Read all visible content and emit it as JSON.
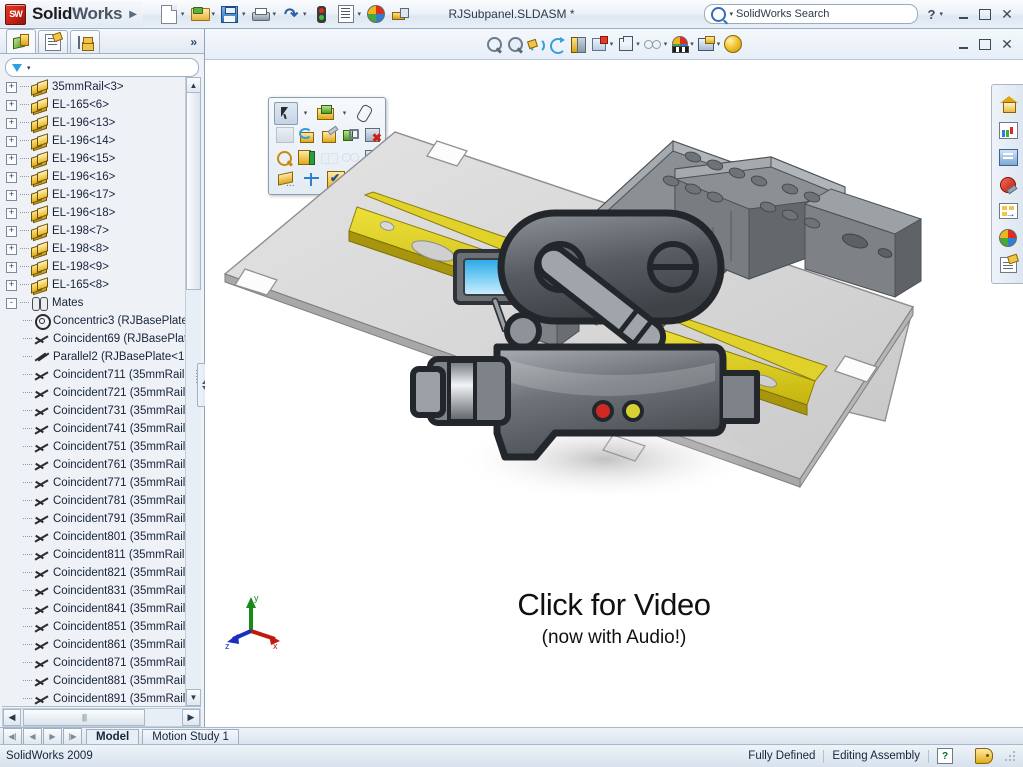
{
  "app": {
    "brand_prefix": "Solid",
    "brand_suffix": "Works",
    "document_title": "RJSubpanel.SLDASM *",
    "version_label": "SolidWorks 2009"
  },
  "titlebar": {
    "menu_caret": "▶",
    "quick_access": [
      {
        "name": "new-document",
        "label": "New",
        "icon": "new-document-icon",
        "has_dropdown": true
      },
      {
        "name": "open-document",
        "label": "Open",
        "icon": "open-folder-icon",
        "has_dropdown": true
      },
      {
        "name": "save-document",
        "label": "Save",
        "icon": "save-disk-icon",
        "has_dropdown": true
      },
      {
        "name": "print-document",
        "label": "Print",
        "icon": "printer-icon",
        "has_dropdown": true
      },
      {
        "name": "undo",
        "label": "Undo",
        "icon": "undo-arrow-icon",
        "has_dropdown": true
      },
      {
        "name": "rebuild",
        "label": "Rebuild",
        "icon": "traffic-light-icon",
        "has_dropdown": false
      },
      {
        "name": "options",
        "label": "Options",
        "icon": "options-list-icon",
        "has_dropdown": true
      },
      {
        "name": "appearances",
        "label": "Edit Appearance",
        "icon": "color-wheel-icon",
        "has_dropdown": false
      },
      {
        "name": "measure",
        "label": "Measure",
        "icon": "measure-icon",
        "has_dropdown": false
      }
    ],
    "search": {
      "placeholder": "SolidWorks Search",
      "value": "SolidWorks Search",
      "icon": "search-magnifier-icon",
      "dropdown": "▾"
    },
    "help_label": "?",
    "help_dropdown": "▾",
    "window_buttons": [
      "minimize",
      "maximize",
      "close"
    ]
  },
  "left_panel": {
    "tabs": [
      {
        "name": "feature-manager",
        "icon": "feature-tree-icon",
        "active": true,
        "title": "FeatureManager design tree"
      },
      {
        "name": "property-manager",
        "icon": "property-manager-icon",
        "active": false,
        "title": "PropertyManager"
      },
      {
        "name": "configuration-manager",
        "icon": "configuration-manager-icon",
        "active": false,
        "title": "ConfigurationManager"
      }
    ],
    "more_tabs_label": "»",
    "filter": {
      "placeholder": "",
      "value": "",
      "icon": "filter-funnel-icon",
      "dropdown": "▾"
    },
    "tree": [
      {
        "label": "35mmRail<3>",
        "icon": "part-icon",
        "expander": "+",
        "depth": 0
      },
      {
        "label": "EL-165<6>",
        "icon": "part-icon",
        "expander": "+",
        "depth": 0
      },
      {
        "label": "EL-196<13>",
        "icon": "part-icon",
        "expander": "+",
        "depth": 0
      },
      {
        "label": "EL-196<14>",
        "icon": "part-icon",
        "expander": "+",
        "depth": 0
      },
      {
        "label": "EL-196<15>",
        "icon": "part-icon",
        "expander": "+",
        "depth": 0
      },
      {
        "label": "EL-196<16>",
        "icon": "part-icon",
        "expander": "+",
        "depth": 0
      },
      {
        "label": "EL-196<17>",
        "icon": "part-icon",
        "expander": "+",
        "depth": 0
      },
      {
        "label": "EL-196<18>",
        "icon": "part-icon",
        "expander": "+",
        "depth": 0
      },
      {
        "label": "EL-198<7>",
        "icon": "part-icon",
        "expander": "+",
        "depth": 0
      },
      {
        "label": "EL-198<8>",
        "icon": "part-icon",
        "expander": "+",
        "depth": 0
      },
      {
        "label": "EL-198<9>",
        "icon": "part-icon",
        "expander": "+",
        "depth": 0
      },
      {
        "label": "EL-165<8>",
        "icon": "part-icon",
        "expander": "+",
        "depth": 0
      },
      {
        "label": "Mates",
        "icon": "mates-folder-icon",
        "expander": "-",
        "depth": 0
      },
      {
        "label": "Concentric3 (RJBasePlate",
        "icon": "concentric-mate-icon",
        "expander": "",
        "depth": 1
      },
      {
        "label": "Coincident69 (RJBasePlat",
        "icon": "coincident-mate-icon",
        "expander": "",
        "depth": 1
      },
      {
        "label": "Parallel2 (RJBasePlate<1:",
        "icon": "parallel-mate-icon",
        "expander": "",
        "depth": 1
      },
      {
        "label": "Coincident711 (35mmRail",
        "icon": "coincident-mate-icon",
        "expander": "",
        "depth": 1
      },
      {
        "label": "Coincident721 (35mmRail",
        "icon": "coincident-mate-icon",
        "expander": "",
        "depth": 1
      },
      {
        "label": "Coincident731 (35mmRail",
        "icon": "coincident-mate-icon",
        "expander": "",
        "depth": 1
      },
      {
        "label": "Coincident741 (35mmRail",
        "icon": "coincident-mate-icon",
        "expander": "",
        "depth": 1
      },
      {
        "label": "Coincident751 (35mmRail",
        "icon": "coincident-mate-icon",
        "expander": "",
        "depth": 1
      },
      {
        "label": "Coincident761 (35mmRail",
        "icon": "coincident-mate-icon",
        "expander": "",
        "depth": 1
      },
      {
        "label": "Coincident771 (35mmRail",
        "icon": "coincident-mate-icon",
        "expander": "",
        "depth": 1
      },
      {
        "label": "Coincident781 (35mmRail",
        "icon": "coincident-mate-icon",
        "expander": "",
        "depth": 1
      },
      {
        "label": "Coincident791 (35mmRail",
        "icon": "coincident-mate-icon",
        "expander": "",
        "depth": 1
      },
      {
        "label": "Coincident801 (35mmRail",
        "icon": "coincident-mate-icon",
        "expander": "",
        "depth": 1
      },
      {
        "label": "Coincident811 (35mmRail",
        "icon": "coincident-mate-icon",
        "expander": "",
        "depth": 1
      },
      {
        "label": "Coincident821 (35mmRail",
        "icon": "coincident-mate-icon",
        "expander": "",
        "depth": 1
      },
      {
        "label": "Coincident831 (35mmRail",
        "icon": "coincident-mate-icon",
        "expander": "",
        "depth": 1
      },
      {
        "label": "Coincident841 (35mmRail",
        "icon": "coincident-mate-icon",
        "expander": "",
        "depth": 1
      },
      {
        "label": "Coincident851 (35mmRail",
        "icon": "coincident-mate-icon",
        "expander": "",
        "depth": 1
      },
      {
        "label": "Coincident861 (35mmRail",
        "icon": "coincident-mate-icon",
        "expander": "",
        "depth": 1
      },
      {
        "label": "Coincident871 (35mmRail",
        "icon": "coincident-mate-icon",
        "expander": "",
        "depth": 1
      },
      {
        "label": "Coincident881 (35mmRail",
        "icon": "coincident-mate-icon",
        "expander": "",
        "depth": 1
      },
      {
        "label": "Coincident891 (35mmRail",
        "icon": "coincident-mate-icon",
        "expander": "",
        "depth": 1
      }
    ],
    "scroll_up": "▲",
    "scroll_down": "▼",
    "scroll_left": "◄",
    "scroll_right": "►"
  },
  "view_toolbar": [
    {
      "name": "zoom-to-fit",
      "icon": "zoom-to-fit-icon",
      "label": "Zoom to Fit",
      "has_dropdown": false
    },
    {
      "name": "zoom-to-area",
      "icon": "zoom-to-area-icon",
      "label": "Zoom to Area",
      "has_dropdown": false
    },
    {
      "name": "previous-view",
      "icon": "previous-view-icon",
      "label": "Previous View",
      "has_dropdown": false
    },
    {
      "name": "rotate-view",
      "icon": "rotate-view-icon",
      "label": "Rotate View",
      "has_dropdown": false
    },
    {
      "name": "section-view",
      "icon": "section-view-icon",
      "label": "Section View",
      "has_dropdown": false
    },
    {
      "name": "view-orientation",
      "icon": "view-orientation-icon",
      "label": "View Orientation",
      "has_dropdown": true
    },
    {
      "name": "display-style",
      "icon": "display-style-icon",
      "label": "Display Style",
      "has_dropdown": true
    },
    {
      "name": "hide-show-items",
      "icon": "hide-show-icon",
      "label": "Hide/Show Items",
      "has_dropdown": true
    },
    {
      "name": "edit-appearance",
      "icon": "appearance-wheel-icon",
      "label": "Edit Appearance",
      "has_dropdown": true
    },
    {
      "name": "apply-scene",
      "icon": "apply-scene-icon",
      "label": "Apply Scene",
      "has_dropdown": true
    },
    {
      "name": "view-settings",
      "icon": "shadow-ball-icon",
      "label": "View Settings",
      "has_dropdown": false
    }
  ],
  "document_window_buttons": [
    "minimize",
    "restore",
    "close"
  ],
  "context_toolbar": {
    "rows": [
      [
        {
          "name": "select",
          "icon": "select-arrow-icon",
          "state": "selected",
          "has_dropdown": true
        },
        {
          "name": "open-part",
          "icon": "open-part-icon",
          "state": "normal",
          "has_dropdown": true
        },
        {
          "name": "attach-note",
          "icon": "paperclip-icon",
          "state": "normal",
          "has_dropdown": false
        }
      ],
      [
        {
          "name": "hide-component",
          "icon": "hide-component-icon",
          "state": "disabled",
          "has_dropdown": false
        },
        {
          "name": "change-transparency",
          "icon": "transparency-icon",
          "state": "normal",
          "has_dropdown": false
        },
        {
          "name": "suppress",
          "icon": "suppress-icon",
          "state": "normal",
          "has_dropdown": false
        },
        {
          "name": "isolate",
          "icon": "isolate-icon",
          "state": "normal",
          "has_dropdown": false
        },
        {
          "name": "delete-component",
          "icon": "delete-component-icon",
          "state": "normal",
          "has_dropdown": false
        }
      ],
      [
        {
          "name": "zoom-to-selection",
          "icon": "zoom-to-selection-icon",
          "state": "normal",
          "has_dropdown": false
        },
        {
          "name": "fix-component",
          "icon": "fix-component-icon",
          "state": "normal",
          "has_dropdown": false
        },
        {
          "name": "show-hidden",
          "icon": "show-hidden-icon",
          "state": "disabled",
          "has_dropdown": false
        },
        {
          "name": "view-mates",
          "icon": "glasses-icon",
          "state": "disabled",
          "has_dropdown": false
        },
        {
          "name": "add-mate",
          "icon": "add-mate-icon",
          "state": "normal",
          "has_dropdown": false
        }
      ],
      [
        {
          "name": "component-properties",
          "icon": "component-properties-icon",
          "state": "normal",
          "has_dropdown": false
        },
        {
          "name": "mass-properties",
          "icon": "balance-scale-icon",
          "state": "normal",
          "has_dropdown": false
        },
        {
          "name": "confirm",
          "icon": "confirm-check-icon",
          "state": "normal",
          "has_dropdown": false
        }
      ]
    ]
  },
  "graphics": {
    "video_overlay": {
      "line1": "Click for Video",
      "line2": "(now with Audio!)",
      "icon": "video-camera-icon"
    },
    "triad": {
      "x_label": "x",
      "y_label": "y",
      "z_label": "z",
      "name": "coordinate-triad"
    },
    "model_colors": {
      "plate": "#d9d9d9",
      "plate_edge": "#9a9a9a",
      "din_rail": "#d8c81e",
      "din_rail_dark": "#a89a10",
      "terminal_block": "#8c8c8c",
      "terminal_block_dark": "#5f5f5f",
      "background": "#ffffff"
    }
  },
  "right_toolbar": [
    {
      "name": "solidworks-resources",
      "icon": "home-icon"
    },
    {
      "name": "design-library",
      "icon": "chart-library-icon"
    },
    {
      "name": "file-explorer",
      "icon": "file-explorer-icon"
    },
    {
      "name": "search",
      "icon": "search-red-icon"
    },
    {
      "name": "view-palette",
      "icon": "view-palette-icon"
    },
    {
      "name": "appearances-scenes",
      "icon": "appearance-wheel-icon"
    },
    {
      "name": "custom-properties",
      "icon": "custom-properties-icon"
    }
  ],
  "document_tabs": {
    "nav_buttons": [
      "first",
      "previous",
      "next",
      "last"
    ],
    "tabs": [
      {
        "name": "tab-model",
        "label": "Model",
        "active": true
      },
      {
        "name": "tab-motion-study",
        "label": "Motion Study 1",
        "active": false
      }
    ]
  },
  "status_bar": {
    "left": "SolidWorks 2009",
    "state": "Fully Defined",
    "mode": "Editing Assembly",
    "help_glyph": "?",
    "tag_icon": "tag-icon",
    "resize_grip": "resize-grip"
  }
}
